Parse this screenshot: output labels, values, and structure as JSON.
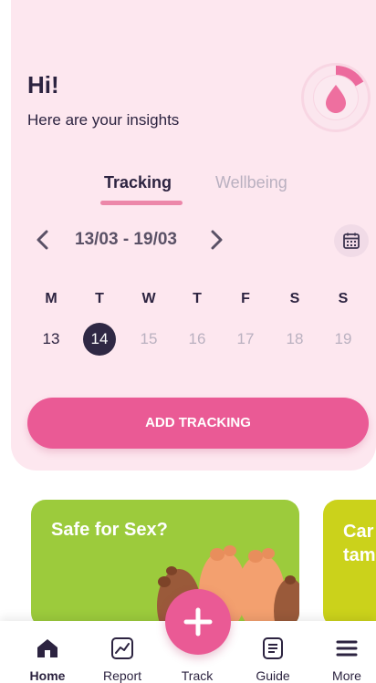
{
  "header": {
    "greeting": "Hi!",
    "subtitle": "Here are your insights",
    "cycle_icon": "droplet-ring-icon"
  },
  "tabs": [
    {
      "label": "Tracking",
      "active": true
    },
    {
      "label": "Wellbeing",
      "active": false
    }
  ],
  "week": {
    "range": "13/03 - 19/03",
    "prev_icon": "chevron-left-icon",
    "next_icon": "chevron-right-icon",
    "calendar_icon": "calendar-icon",
    "weekdays": [
      "M",
      "T",
      "W",
      "T",
      "F",
      "S",
      "S"
    ],
    "dates": [
      "13",
      "14",
      "15",
      "16",
      "17",
      "18",
      "19"
    ],
    "selected_date": "14"
  },
  "add_tracking_label": "ADD TRACKING",
  "articles": [
    {
      "title": "Safe for Sex?",
      "color": "#9ccb3c"
    },
    {
      "title": "Car\ntam",
      "color": "#cbd21b"
    }
  ],
  "bottom_nav": {
    "home": "Home",
    "report": "Report",
    "track": "Track",
    "guide": "Guide",
    "more": "More"
  },
  "colors": {
    "accent_pink": "#ea5a95",
    "card_background": "#fde7ef",
    "dark_text": "#2c2340",
    "muted_text": "#bab1c0",
    "selected_date_bg": "#2f2844"
  }
}
